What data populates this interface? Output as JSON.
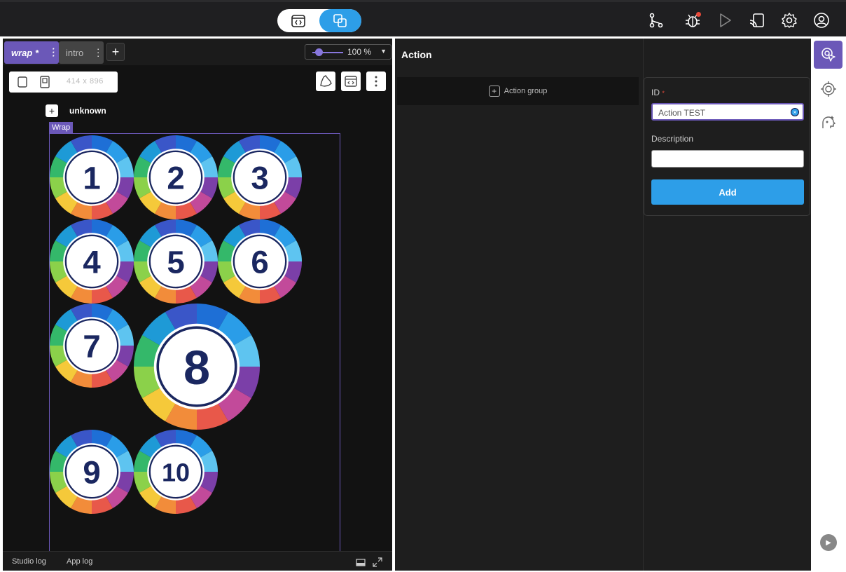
{
  "tabs": [
    {
      "label": "wrap *",
      "active": true
    },
    {
      "label": "intro",
      "active": false
    }
  ],
  "zoom": {
    "value": "100 %",
    "level": 1.0
  },
  "device": {
    "size_label": "414 x 896"
  },
  "tree": {
    "parent_label": "unknown",
    "wrap_label": "Wrap"
  },
  "balls": [
    "1",
    "2",
    "3",
    "4",
    "5",
    "6",
    "7",
    "8",
    "9",
    "10"
  ],
  "bottom": {
    "studio_log": "Studio log",
    "app_log": "App log"
  },
  "action": {
    "title": "Action",
    "group_label": "Action group"
  },
  "form": {
    "id_label": "ID",
    "id_required_mark": "*",
    "id_value": "Action TEST",
    "description_label": "Description",
    "description_value": "",
    "add_label": "Add"
  },
  "icons": {
    "top": [
      "code-view-icon",
      "design-view-icon",
      "branch-icon",
      "debug-icon",
      "play-icon",
      "cast-icon",
      "settings-icon",
      "account-icon"
    ],
    "rail": [
      "action-pointer-icon",
      "target-icon",
      "ai-assist-icon"
    ]
  },
  "colors": {
    "accent": "#6b58b8",
    "primary": "#2d9ee8",
    "notification": "#e84a3a"
  }
}
